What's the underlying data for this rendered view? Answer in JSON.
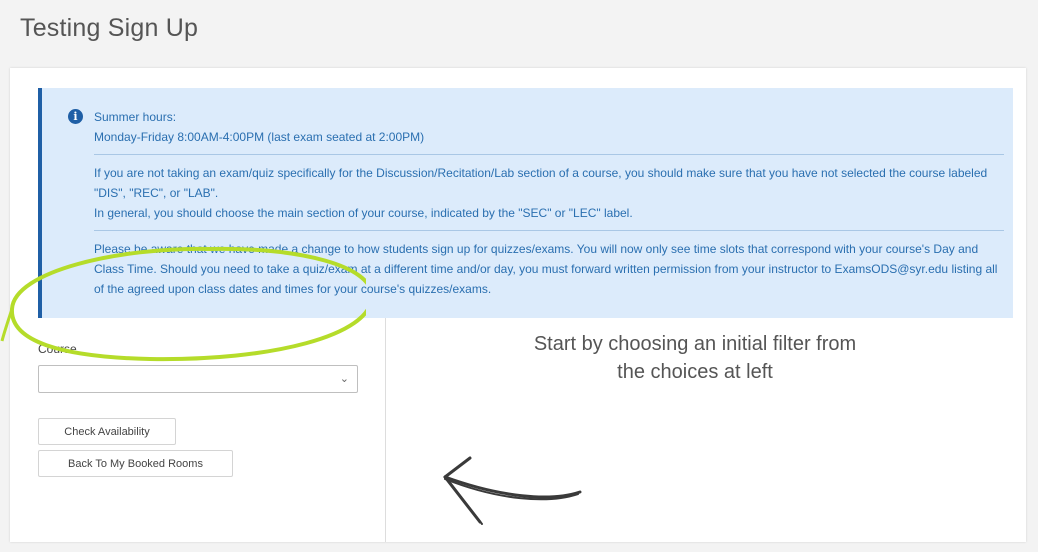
{
  "page": {
    "title": "Testing Sign Up"
  },
  "alert": {
    "lines": [
      "Summer hours:",
      "Monday-Friday 8:00AM-4:00PM (last exam seated at 2:00PM)",
      "If you are not taking an exam/quiz specifically for the Discussion/Recitation/Lab section of a course, you should make sure that you have not selected the course labeled \"DIS\", \"REC\", or \"LAB\".",
      "In general, you should choose the main section of your course, indicated by the \"SEC\" or \"LEC\" label.",
      "Please be aware that we have made a change to how students sign up for quizzes/exams. You will now only see time slots that correspond with your course's Day and Class Time. Should you need to take a quiz/exam at a different time and/or day, you must forward written permission from your instructor to ExamsODS@syr.edu listing all of the agreed upon class dates and times for your course's quizzes/exams."
    ]
  },
  "form": {
    "course_label": "Course",
    "course_value": "",
    "check_availability": "Check Availability",
    "back_to_booked": "Back To My Booked Rooms"
  },
  "empty_state": {
    "message": "Start by choosing an initial filter from the choices at left"
  },
  "colors": {
    "alert_bg": "#dcebfb",
    "alert_text": "#2a6fb0",
    "alert_border": "#1f5fa6",
    "highlight": "#b5dc2a"
  },
  "icons": {
    "info": "info-icon",
    "select_chevron": "chevron-down-icon",
    "annotation_arrow": "arrow-icon"
  }
}
